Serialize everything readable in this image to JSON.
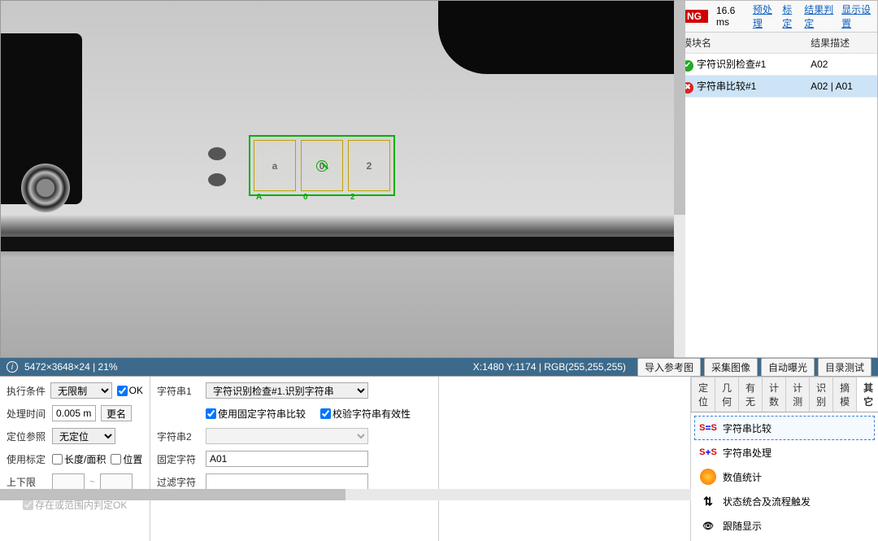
{
  "status": {
    "verdict": "NG",
    "time": "16.6 ms"
  },
  "topLinks": [
    "预处理",
    "标定",
    "结果判定",
    "显示设置"
  ],
  "resultTable": {
    "headers": [
      "模块名",
      "结果描述"
    ],
    "rows": [
      {
        "status": "ok",
        "name": "字符识别检查#1",
        "desc": "A02"
      },
      {
        "status": "ng",
        "name": "字符串比较#1",
        "desc": "A02 | A01"
      }
    ]
  },
  "roi": {
    "chars": [
      {
        "glyph": "a",
        "label": "A"
      },
      {
        "glyph": "0",
        "label": "0"
      },
      {
        "glyph": "2",
        "label": "2"
      }
    ]
  },
  "infoBar": {
    "imgInfo": "5472×3648×24 | 21%",
    "coords": "X:1480 Y:1174 | RGB(255,255,255)",
    "buttons": [
      "导入参考图",
      "采集图像",
      "自动曝光",
      "目录测试"
    ]
  },
  "panelA": {
    "execCondLabel": "执行条件",
    "execCondValue": "无限制",
    "okLabel": "OK",
    "procTimeLabel": "处理时间",
    "procTimeValue": "0.005 ms",
    "renameBtn": "更名",
    "locRefLabel": "定位参照",
    "locRefValue": "无定位",
    "useCalibLabel": "使用标定",
    "lenAreaLabel": "长度/面积",
    "positionLabel": "位置",
    "rangeLabel": "上下限",
    "rangeSep": "~",
    "rangeOkLabel": "存在或范围内判定OK"
  },
  "panelB": {
    "str1Label": "字符串1",
    "str1Value": "字符识别检查#1.识别字符串",
    "useFixedLabel": "使用固定字符串比较",
    "validateLabel": "校验字符串有效性",
    "str2Label": "字符串2",
    "fixedLabel": "固定字符",
    "fixedValue": "A01",
    "filterLabel": "过滤字符",
    "filterValue": ""
  },
  "tabs": [
    "定位",
    "几何",
    "有无",
    "计数",
    "计测",
    "识别",
    "摘模",
    "其它"
  ],
  "activeTab": "其它",
  "tools": [
    {
      "icon": "ss",
      "label": "字符串比较",
      "selected": true
    },
    {
      "icon": "ss",
      "label": "字符串处理"
    },
    {
      "icon": "stat",
      "label": "数值统计"
    },
    {
      "icon": "flow",
      "label": "状态统合及流程触发"
    },
    {
      "icon": "follow",
      "label": "跟随显示"
    }
  ]
}
